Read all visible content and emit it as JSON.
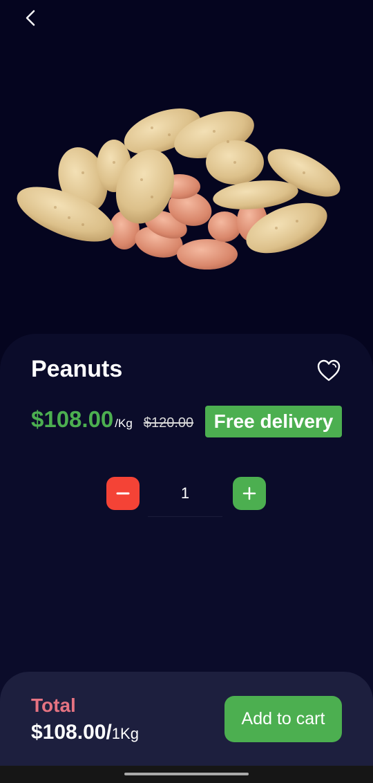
{
  "header": {
    "back_icon": "chevron-left-icon"
  },
  "product": {
    "image_icon": "peanuts-image",
    "title": "Peanuts",
    "favorite_icon": "heart-outline-icon",
    "price": "$108.00",
    "unit": "/Kg",
    "old_price": "$120.00",
    "badge": "Free delivery"
  },
  "quantity": {
    "minus_icon": "minus-icon",
    "value": "1",
    "plus_icon": "plus-icon"
  },
  "footer": {
    "total_label": "Total",
    "total_price": "$108.00/",
    "total_unit": "1Kg",
    "add_to_cart_label": "Add to cart"
  },
  "colors": {
    "background": "#05051f",
    "panel": "#0b0c2a",
    "bottom_bar": "#1d1f3e",
    "accent_green": "#4caf50",
    "accent_red": "#f44336",
    "total_label": "#e57382"
  }
}
